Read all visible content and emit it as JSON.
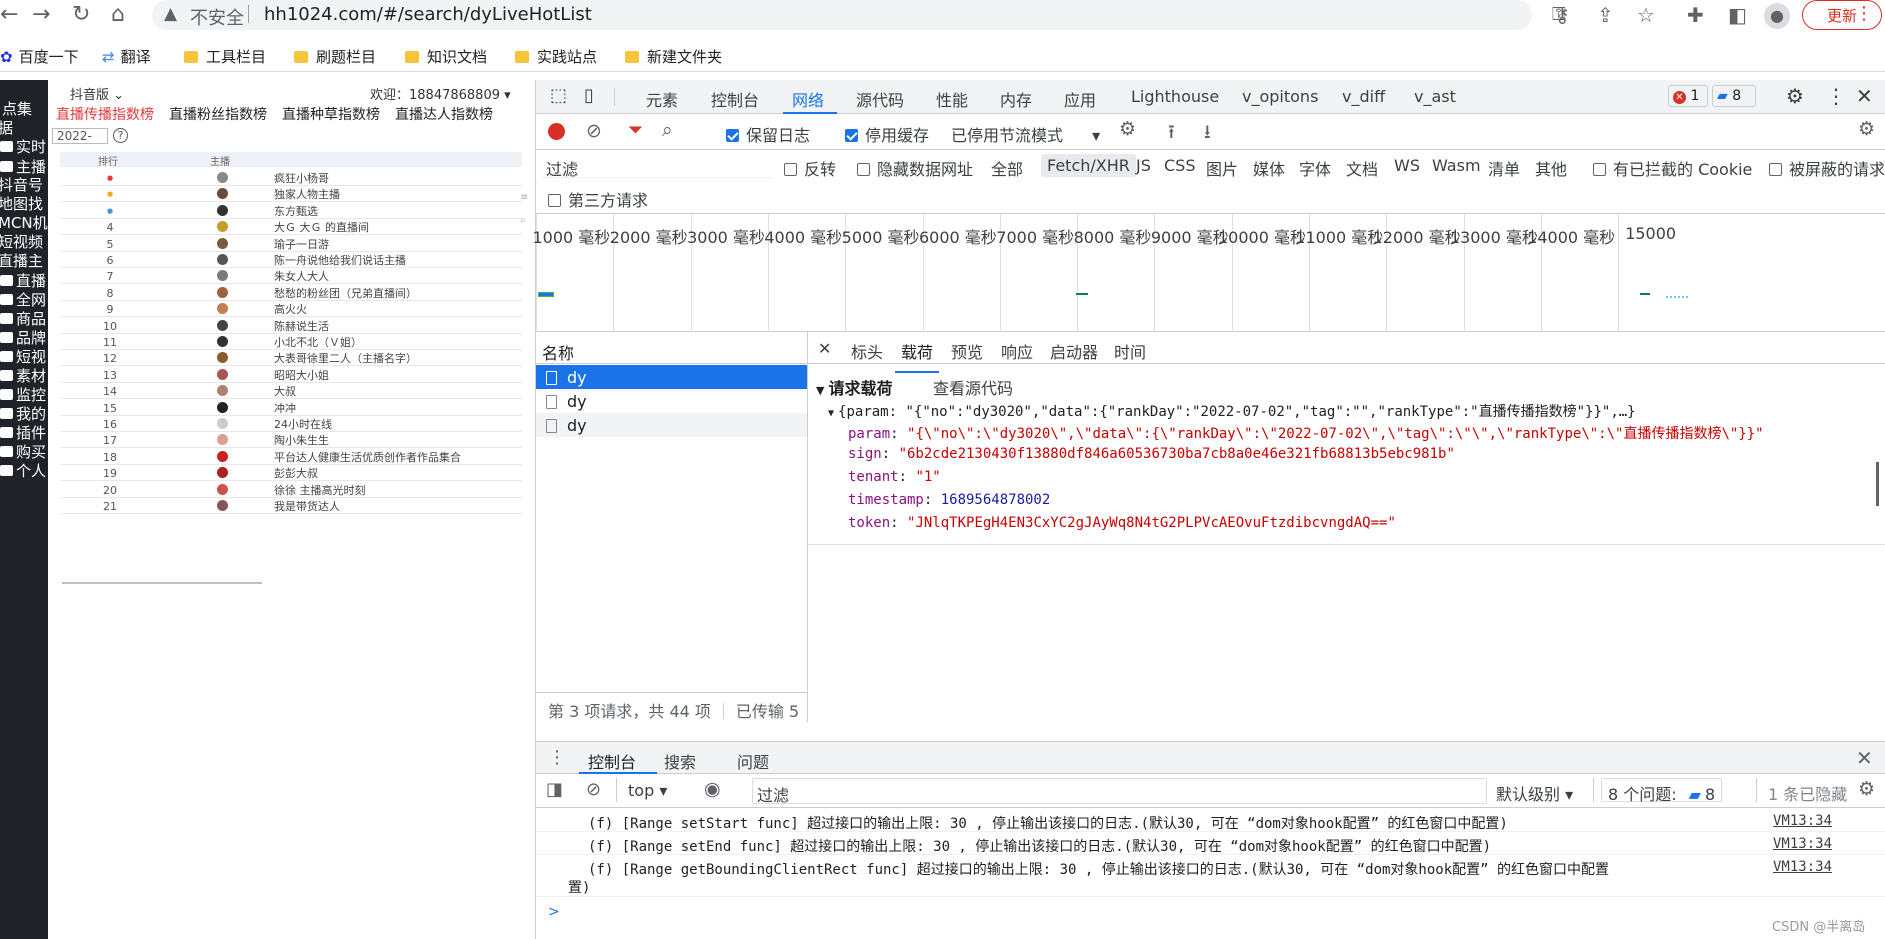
{
  "browser": {
    "insecure_label": "不安全",
    "url": "hh1024.com/#/search/dyLiveHotList",
    "update_label": "更新",
    "bookmarks": [
      "百度一下",
      "翻译",
      "工具栏目",
      "刷题栏目",
      "知识文档",
      "实践站点",
      "新建文件夹"
    ]
  },
  "left_sidebar": {
    "items": [
      "点集",
      "据",
      "实时",
      "主播",
      "抖音号",
      "地图找",
      "MCN机",
      "短视频",
      "直播主",
      "直播",
      "全网",
      "商品",
      "品牌",
      "短视",
      "素材",
      "监控",
      "我的",
      "插件",
      "购买",
      "个人"
    ]
  },
  "app": {
    "platform_label": "抖音版",
    "welcome": "欢迎：18847868809",
    "tabs": [
      "直播传播指数榜",
      "直播粉丝指数榜",
      "直播种草指数榜",
      "直播达人指数榜"
    ],
    "date_value": "2022-",
    "col_rank": "排行",
    "col_anchor": "主播",
    "rows": [
      {
        "rank": "1",
        "name": "疯狂小杨哥"
      },
      {
        "rank": "2",
        "name": "独家人物主播"
      },
      {
        "rank": "3",
        "name": "东方甄选"
      },
      {
        "rank": "4",
        "name": "大Ｇ 大Ｇ 的直播间"
      },
      {
        "rank": "5",
        "name": "瑜子一日游"
      },
      {
        "rank": "6",
        "name": "陈一舟说他给我们说话主播"
      },
      {
        "rank": "7",
        "name": "朱女人大人"
      },
      {
        "rank": "8",
        "name": "愁愁的粉丝团（兄弟直播间）"
      },
      {
        "rank": "9",
        "name": "高火火"
      },
      {
        "rank": "10",
        "name": "陈赫说生活"
      },
      {
        "rank": "11",
        "name": "小北不北（Ｖ姐）"
      },
      {
        "rank": "12",
        "name": "大表哥徐里二人（主播名字）"
      },
      {
        "rank": "13",
        "name": "昭昭大小姐"
      },
      {
        "rank": "14",
        "name": "大叔"
      },
      {
        "rank": "15",
        "name": "冲冲"
      },
      {
        "rank": "16",
        "name": "24小时在线"
      },
      {
        "rank": "17",
        "name": "陶小朱生生"
      },
      {
        "rank": "18",
        "name": "平台达人健康生活优质创作者作品集合"
      },
      {
        "rank": "19",
        "name": "彭彭大叔"
      },
      {
        "rank": "20",
        "name": "徐徐 主播高光时刻"
      },
      {
        "rank": "21",
        "name": "我是带货达人"
      }
    ]
  },
  "devtools": {
    "tabs": [
      "元素",
      "控制台",
      "网络",
      "源代码",
      "性能",
      "内存",
      "应用",
      "Lighthouse",
      "v_opitons",
      "v_diff",
      "v_ast"
    ],
    "active_tab": "网络",
    "error_count": "1",
    "message_count": "8",
    "network": {
      "preserve_log": "保留日志",
      "disable_cache": "停用缓存",
      "throttle": "已停用节流模式",
      "filter_placeholder": "过滤",
      "filter_opts": [
        "反转",
        "隐藏数据网址",
        "全部",
        "Fetch/XHR",
        "JS",
        "CSS",
        "图片",
        "媒体",
        "字体",
        "文档",
        "WS",
        "Wasm",
        "清单",
        "其他",
        "有已拦截的 Cookie",
        "被屏蔽的请求"
      ],
      "third_party": "第三方请求",
      "timeline_ticks": [
        "1000 毫秒",
        "2000 毫秒",
        "3000 毫秒",
        "4000 毫秒",
        "5000 毫秒",
        "6000 毫秒",
        "7000 毫秒",
        "8000 毫秒",
        "9000 毫秒",
        "10000 毫秒",
        "11000 毫秒",
        "12000 毫秒",
        "13000 毫秒",
        "14000 毫秒",
        "15000"
      ],
      "name_header": "名称",
      "requests": [
        "dy",
        "dy",
        "dy"
      ],
      "footer": "第 3 项请求，共 44 项",
      "footer2": "已传输 5",
      "detail_tabs": [
        "标头",
        "载荷",
        "预览",
        "响应",
        "启动器",
        "时间"
      ],
      "payload_title": "请求载荷",
      "view_source": "查看源代码",
      "payload_summary": "{param: \"{\"no\":\"dy3020\",\"data\":{\"rankDay\":\"2022-07-02\",\"tag\":\"\",\"rankType\":\"直播传播指数榜\"}}\",…}",
      "payload": {
        "param_key": "param",
        "param_val": "\"{\\\"no\\\":\\\"dy3020\\\",\\\"data\\\":{\\\"rankDay\\\":\\\"2022-07-02\\\",\\\"tag\\\":\\\"\\\",\\\"rankType\\\":\\\"直播传播指数榜\\\"}}\"",
        "sign_key": "sign",
        "sign_val": "\"6b2cde2130430f13880df846a60536730ba7cb8a0e46e321fb68813b5ebc981b\"",
        "tenant_key": "tenant",
        "tenant_val": "\"1\"",
        "timestamp_key": "timestamp",
        "timestamp_val": "1689564878002",
        "token_key": "token",
        "token_val": "\"JNlqTKPEgH4EN3CxYC2gJAyWq8N4tG2PLPVcAEOvuFtzdibcvngdAQ==\""
      }
    },
    "drawer": {
      "tabs": [
        "控制台",
        "搜索",
        "问题"
      ],
      "context": "top",
      "filter_placeholder": "过滤",
      "level": "默认级别",
      "issues": "8 个问题:",
      "issues_count": "8",
      "hidden": "1 条已隐藏",
      "logs": [
        {
          "text": "(f) [Range setStart func] 超过接口的输出上限: 30 , 停止输出该接口的日志.(默认30, 可在 “dom对象hook配置” 的红色窗口中配置)",
          "src": "VM13:34"
        },
        {
          "text": "(f) [Range setEnd func] 超过接口的输出上限: 30 , 停止输出该接口的日志.(默认30, 可在 “dom对象hook配置” 的红色窗口中配置)",
          "src": "VM13:34"
        },
        {
          "text": "(f) [Range getBoundingClientRect func] 超过接口的输出上限: 30 , 停止输出该接口的日志.(默认30, 可在 “dom对象hook配置” 的红色窗口中配置",
          "text2": "置)",
          "src": "VM13:34"
        }
      ],
      "prompt": ">"
    }
  },
  "watermark": "CSDN @半离岛",
  "colors": {
    "accent": "#1a73e8",
    "app_tab_active": "#e4393c",
    "sidebar": "#1f2229"
  }
}
